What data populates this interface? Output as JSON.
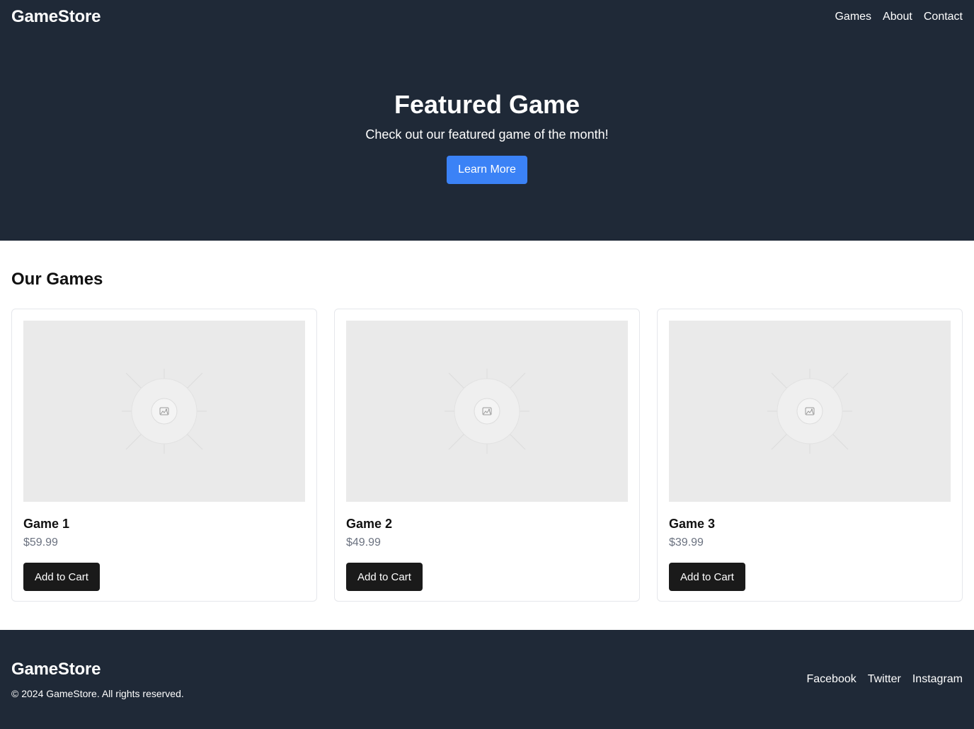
{
  "nav": {
    "brand": "GameStore",
    "links": [
      "Games",
      "About",
      "Contact"
    ]
  },
  "hero": {
    "title": "Featured Game",
    "subtitle": "Check out our featured game of the month!",
    "button": "Learn More"
  },
  "games": {
    "heading": "Our Games",
    "items": [
      {
        "title": "Game 1",
        "price": "$59.99",
        "button": "Add to Cart",
        "image_icon": "image-placeholder-icon"
      },
      {
        "title": "Game 2",
        "price": "$49.99",
        "button": "Add to Cart",
        "image_icon": "image-placeholder-icon"
      },
      {
        "title": "Game 3",
        "price": "$39.99",
        "button": "Add to Cart",
        "image_icon": "image-placeholder-icon"
      }
    ]
  },
  "footer": {
    "brand": "GameStore",
    "copyright": "© 2024 GameStore. All rights reserved.",
    "social": [
      "Facebook",
      "Twitter",
      "Instagram"
    ]
  },
  "colors": {
    "header_bg": "#1f2937",
    "primary": "#3b82f6",
    "dark_button": "#1a1a1a",
    "price": "#6b7280",
    "placeholder_bg": "#eaeaea"
  }
}
